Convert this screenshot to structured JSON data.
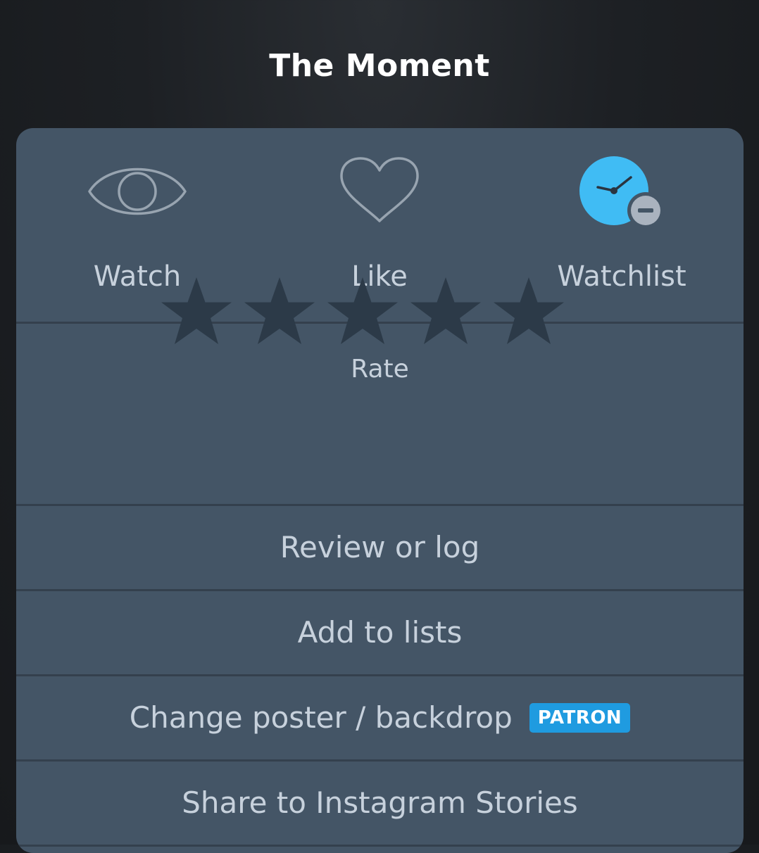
{
  "header": {
    "title": "The Moment"
  },
  "actions": [
    {
      "label": "Watch",
      "icon": "eye-icon",
      "active": false
    },
    {
      "label": "Like",
      "icon": "heart-icon",
      "active": false
    },
    {
      "label": "Watchlist",
      "icon": "clock-remove-icon",
      "active": true
    }
  ],
  "rating": {
    "label": "Rate",
    "value": 0,
    "max": 5
  },
  "menu": {
    "review": "Review or log",
    "add_to_lists": "Add to lists",
    "change_poster": "Change poster / backdrop",
    "patron_badge": "PATRON",
    "share": "Share to Instagram Stories"
  },
  "colors": {
    "sheet_background": "#445566",
    "divider": "#34404d",
    "text": "#c7d1dc",
    "accent_blue": "#40bcf4",
    "badge_blue": "#1f9be0",
    "star_empty": "#2c3a48"
  }
}
